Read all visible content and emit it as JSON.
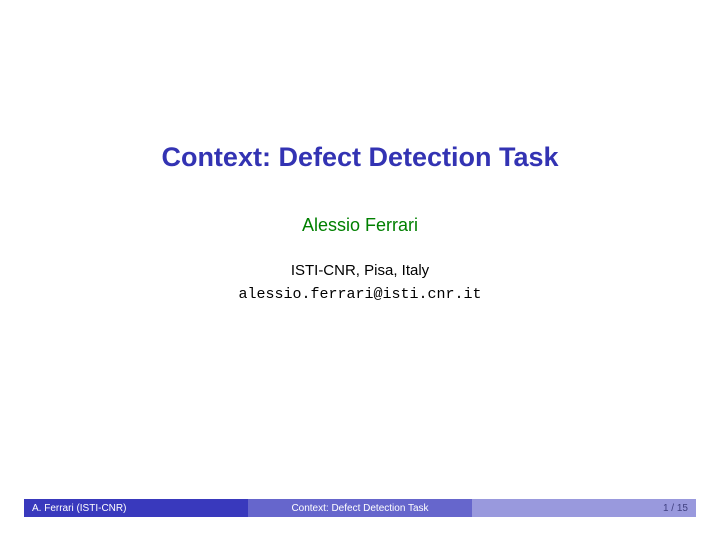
{
  "title": "Context: Defect Detection Task",
  "author": "Alessio Ferrari",
  "affiliation": "ISTI-CNR, Pisa, Italy",
  "email": "alessio.ferrari@isti.cnr.it",
  "footer": {
    "left": "A. Ferrari (ISTI-CNR)",
    "center": "Context: Defect Detection Task",
    "right": "1 / 15"
  }
}
